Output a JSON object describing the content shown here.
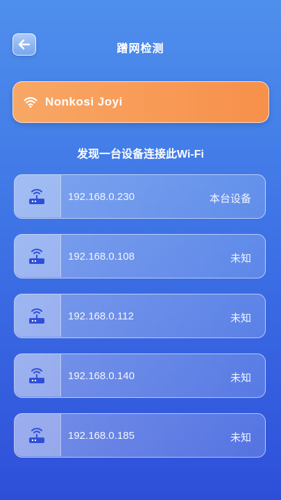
{
  "header": {
    "back_icon": "arrow-left-icon",
    "title": "蹭网检测"
  },
  "wifi": {
    "icon": "wifi-icon",
    "name": "Nonkosi Joyi",
    "accent": "#f7904a"
  },
  "summary": {
    "text": "发现一台设备连接此Wi-Fi"
  },
  "devices": [
    {
      "icon": "router-icon",
      "ip": "192.168.0.230",
      "status": "本台设备"
    },
    {
      "icon": "router-icon",
      "ip": "192.168.0.108",
      "status": "未知"
    },
    {
      "icon": "router-icon",
      "ip": "192.168.0.112",
      "status": "未知"
    },
    {
      "icon": "router-icon",
      "ip": "192.168.0.140",
      "status": "未知"
    },
    {
      "icon": "router-icon",
      "ip": "192.168.0.185",
      "status": "未知"
    }
  ],
  "colors": {
    "background_top": "#4f8fec",
    "background_bottom": "#2e4fd9",
    "icon_blue": "#2f4fd6"
  }
}
